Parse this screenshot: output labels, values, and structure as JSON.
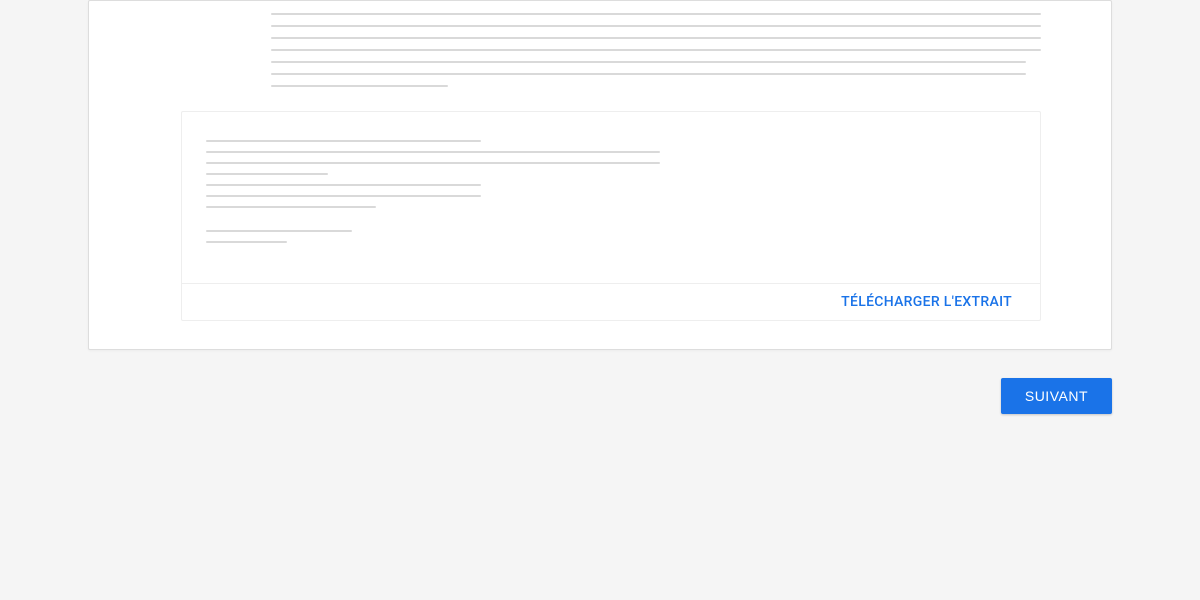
{
  "codeBox": {
    "downloadLabel": "TÉLÉCHARGER L'EXTRAIT"
  },
  "actions": {
    "nextLabel": "SUIVANT"
  }
}
